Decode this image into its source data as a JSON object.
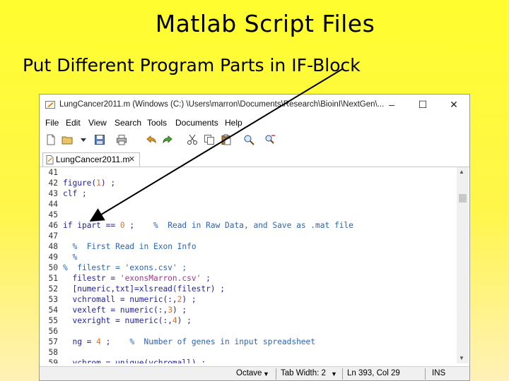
{
  "slide": {
    "title": "Matlab Script Files",
    "subtitle": "Put Different Program Parts in IF-Block"
  },
  "window": {
    "title": "LungCancer2011.m (Windows (C:) \\Users\\marron\\Documents\\Research\\BioinI\\NextGen\\...",
    "minimize": "–",
    "maximize": "☐",
    "close": "✕"
  },
  "menu": [
    "File",
    "Edit",
    "View",
    "Search",
    "Tools",
    "Documents",
    "Help"
  ],
  "toolbar": [
    "new-file-icon",
    "open-folder-icon",
    "dropdown-icon",
    "save-icon",
    "print-icon",
    "undo-icon",
    "redo-icon",
    "cut-icon",
    "copy-icon",
    "paste-icon",
    "find-icon"
  ],
  "tab": {
    "label": "LungCancer2011.m",
    "close": "✕"
  },
  "code_lines": [
    {
      "n": "41",
      "t": ""
    },
    {
      "n": "42",
      "t": "figure(1) ;"
    },
    {
      "n": "43",
      "t": "clf ;"
    },
    {
      "n": "44",
      "t": ""
    },
    {
      "n": "45",
      "t": ""
    },
    {
      "n": "46",
      "t": "if ipart == 0 ;    %  Read in Raw Data, and Save as .mat file"
    },
    {
      "n": "47",
      "t": ""
    },
    {
      "n": "48",
      "t": "  %  First Read in Exon Info"
    },
    {
      "n": "49",
      "t": "  %"
    },
    {
      "n": "50",
      "t": "%  filestr = 'exons.csv' ;"
    },
    {
      "n": "51",
      "t": "  filestr = 'exonsMarron.csv' ;"
    },
    {
      "n": "52",
      "t": "  [numeric,txt]=xlsread(filestr) ;"
    },
    {
      "n": "53",
      "t": "  vchromall = numeric(:,2) ;"
    },
    {
      "n": "54",
      "t": "  vexleft = numeric(:,3) ;"
    },
    {
      "n": "55",
      "t": "  vexright = numeric(:,4) ;"
    },
    {
      "n": "56",
      "t": ""
    },
    {
      "n": "57",
      "t": "  ng = 4 ;    %  Number of genes in input spreadsheet"
    },
    {
      "n": "58",
      "t": ""
    },
    {
      "n": "59",
      "t": "  vchrom = unique(vchromall) ;"
    }
  ],
  "status": {
    "language": "Octave",
    "tab_width": "Tab Width: 2",
    "position": "Ln 393, Col 29",
    "mode": "INS"
  },
  "colors": {
    "keyword": "#2323a0",
    "comment": "#2d64b4",
    "number": "#e0712a",
    "string": "#9b3a8a"
  }
}
